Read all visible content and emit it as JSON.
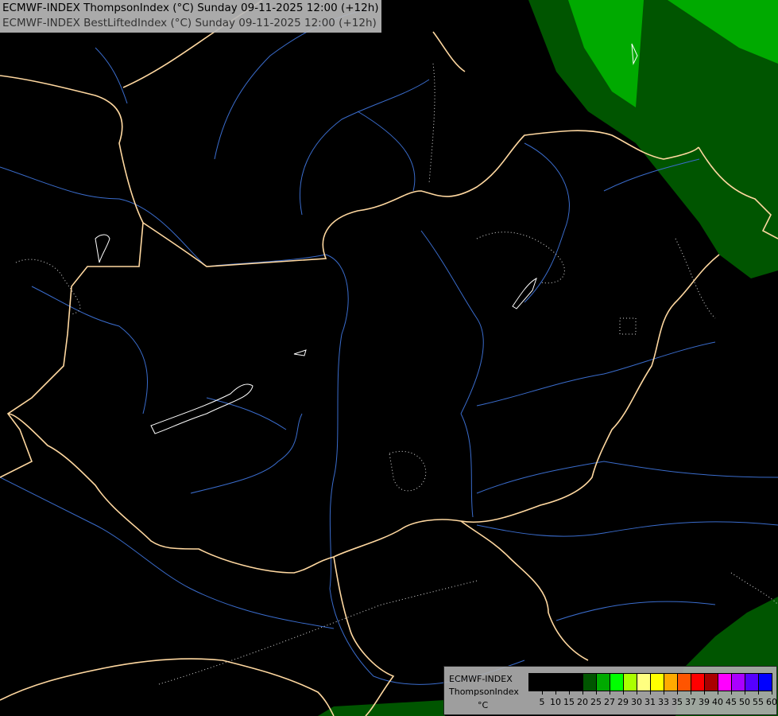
{
  "header": {
    "line1": "ECMWF-INDEX ThompsonIndex (°C) Sunday 09-11-2025 12:00 (+12h)",
    "line2": "ECMWF-INDEX BestLiftedIndex (°C) Sunday 09-11-2025 12:00 (+12h)"
  },
  "legend": {
    "source": "ECMWF-INDEX",
    "parameter": "ThompsonIndex",
    "unit": "°C",
    "colors": [
      "#000000",
      "#000000",
      "#000000",
      "#000000",
      "#005500",
      "#00aa00",
      "#00ff00",
      "#aaff00",
      "#ffff80",
      "#ffff00",
      "#ffaa00",
      "#ff5500",
      "#ff0000",
      "#aa0000",
      "#ff00ff",
      "#aa00ff",
      "#5500ff",
      "#0000ff"
    ],
    "labels": [
      "5",
      "10",
      "15",
      "20",
      "25",
      "27",
      "29",
      "30",
      "31",
      "33",
      "35",
      "37",
      "39",
      "40",
      "45",
      "50",
      "55",
      "60"
    ]
  },
  "colors": {
    "border": "#ffd8a0",
    "river": "#3a6ccc",
    "field_dark": "#005500",
    "field_mid": "#00aa00"
  }
}
